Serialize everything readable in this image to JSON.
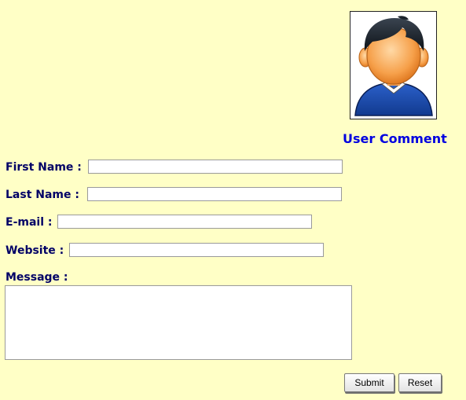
{
  "avatar": {
    "icon": "user-avatar-icon"
  },
  "form": {
    "title": "User Comment",
    "first_name_label": "First Name :",
    "first_name_value": "",
    "last_name_label": "Last Name :",
    "last_name_value": "",
    "email_label": "E-mail :",
    "email_value": "",
    "website_label": "Website :",
    "website_value": "",
    "message_label": "Message :",
    "message_value": "",
    "submit_label": "Submit",
    "reset_label": "Reset"
  },
  "colors": {
    "background": "#ffffc6",
    "title": "#0000e0",
    "label": "#000066"
  }
}
